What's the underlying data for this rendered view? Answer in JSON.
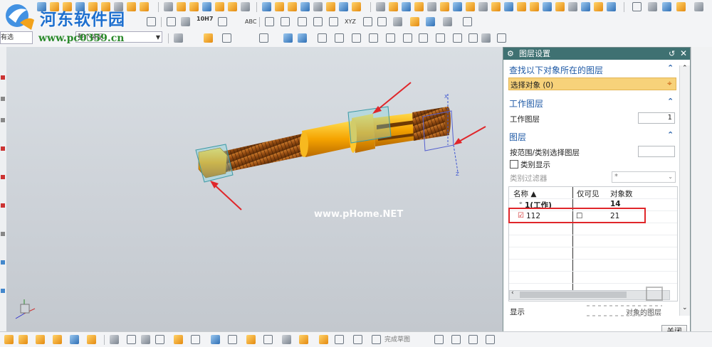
{
  "watermark": {
    "site_title": "河东软件园",
    "site_url": "www.pc0359.cn",
    "viewport_watermark": "www.pHome.NET"
  },
  "toolbar": {
    "filter_select": "有选",
    "assembly_select": "整个装配",
    "gdt_label": "10H7",
    "abc_label": "ABC",
    "xyz_label": "XYZ",
    "finish_sketch_label": "完成草图"
  },
  "dialog": {
    "title": "图层设置",
    "find_section": {
      "heading": "查找以下对象所在的图层",
      "select_label": "选择对象 (0)"
    },
    "work_layer_section": {
      "heading": "工作图层",
      "label": "工作图层",
      "value": "1"
    },
    "layers_section": {
      "heading": "图层",
      "range_label": "按范围/类别选择图层",
      "category_display_label": "类别显示",
      "category_filter_label": "类别过滤器",
      "category_filter_value": "*"
    },
    "table": {
      "columns": [
        "名称 ▲",
        "仅可见",
        "对象数"
      ],
      "rows": [
        {
          "name": "1(工作)",
          "visible_only": "",
          "count": "14"
        },
        {
          "name": "112",
          "visible_only": "☐",
          "count": "21"
        }
      ]
    },
    "display_label": "显示",
    "display_value": "对象的图层",
    "close_button": "关闭"
  },
  "colors": {
    "dialog_header": "#3f7172",
    "section_heading": "#1f5aa6",
    "selection_highlight": "#f7d27a",
    "annotation_red": "#e0262a",
    "part_orange": "#f5a300"
  }
}
